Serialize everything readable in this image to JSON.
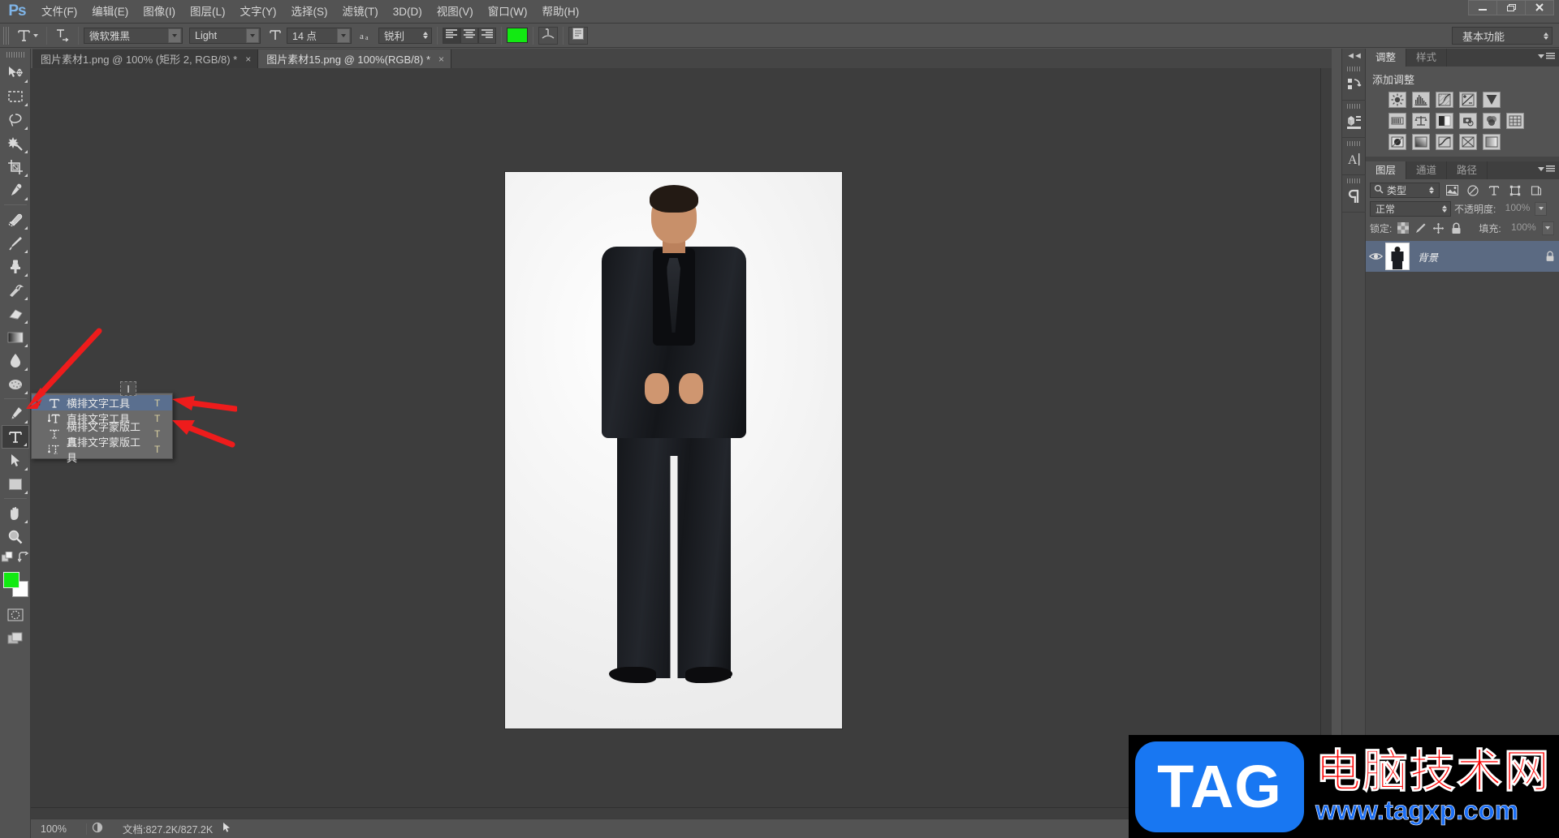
{
  "app": {
    "logo": "Ps",
    "workspace": "基本功能"
  },
  "menubar": {
    "items": [
      {
        "label": "文件(F)"
      },
      {
        "label": "编辑(E)"
      },
      {
        "label": "图像(I)"
      },
      {
        "label": "图层(L)"
      },
      {
        "label": "文字(Y)"
      },
      {
        "label": "选择(S)"
      },
      {
        "label": "滤镜(T)"
      },
      {
        "label": "3D(D)"
      },
      {
        "label": "视图(V)"
      },
      {
        "label": "窗口(W)"
      },
      {
        "label": "帮助(H)"
      }
    ],
    "window_controls": {
      "minimize": "minimize-icon",
      "restore": "restore-icon",
      "close": "close-icon"
    }
  },
  "options_bar": {
    "tool_icon": "horizontal-type-tool-icon",
    "orientation_icon": "toggle-text-orientation-icon",
    "font_family": "微软雅黑",
    "font_style": "Light",
    "size_icon": "font-size-icon",
    "font_size": "14 点",
    "aa_icon": "anti-alias-icon",
    "anti_alias": "锐利",
    "align": {
      "left": "align-left-icon",
      "center": "align-center-icon",
      "right": "align-right-icon",
      "selected": "left"
    },
    "text_color": "#12ea12",
    "warp_icon": "create-warped-text-icon",
    "panels_icon": "toggle-character-paragraph-panels-icon"
  },
  "tabs": [
    {
      "label": "图片素材1.png @ 100% (矩形 2, RGB/8) *",
      "close": "×",
      "active": false
    },
    {
      "label": "图片素材15.png @ 100%(RGB/8) *",
      "close": "×",
      "active": true
    }
  ],
  "toolbar": {
    "tools": [
      {
        "name": "move-tool",
        "icon": "move-tool-icon",
        "has_flyout": true
      },
      {
        "name": "rectangular-marquee-tool",
        "icon": "marquee-tool-icon",
        "has_flyout": true
      },
      {
        "name": "lasso-tool",
        "icon": "lasso-tool-icon",
        "has_flyout": true
      },
      {
        "name": "magic-wand-tool",
        "icon": "magic-wand-tool-icon",
        "has_flyout": true
      },
      {
        "name": "crop-tool",
        "icon": "crop-tool-icon",
        "has_flyout": true
      },
      {
        "name": "eyedropper-tool",
        "icon": "eyedropper-tool-icon",
        "has_flyout": true
      },
      {
        "name": "spot-healing-brush-tool",
        "icon": "healing-brush-tool-icon",
        "has_flyout": true
      },
      {
        "name": "brush-tool",
        "icon": "brush-tool-icon",
        "has_flyout": true
      },
      {
        "name": "clone-stamp-tool",
        "icon": "clone-stamp-tool-icon",
        "has_flyout": true
      },
      {
        "name": "history-brush-tool",
        "icon": "history-brush-tool-icon",
        "has_flyout": true
      },
      {
        "name": "eraser-tool",
        "icon": "eraser-tool-icon",
        "has_flyout": true
      },
      {
        "name": "gradient-tool",
        "icon": "gradient-tool-icon",
        "has_flyout": true
      },
      {
        "name": "blur-tool",
        "icon": "blur-tool-icon",
        "has_flyout": true
      },
      {
        "name": "dodge-tool",
        "icon": "dodge-tool-icon",
        "has_flyout": true
      },
      {
        "name": "pen-tool",
        "icon": "pen-tool-icon",
        "has_flyout": true
      },
      {
        "name": "type-tool",
        "icon": "type-tool-icon",
        "has_flyout": true,
        "selected": true
      },
      {
        "name": "path-selection-tool",
        "icon": "path-selection-tool-icon",
        "has_flyout": true
      },
      {
        "name": "rectangle-tool",
        "icon": "rectangle-shape-tool-icon",
        "has_flyout": true
      },
      {
        "name": "hand-tool",
        "icon": "hand-tool-icon",
        "has_flyout": true
      },
      {
        "name": "zoom-tool",
        "icon": "zoom-tool-icon",
        "has_flyout": false
      }
    ],
    "foreground_color": "#12ea12",
    "background_color": "#ffffff",
    "quick_mask_icon": "quick-mask-icon",
    "screen_mode_icon": "screen-mode-icon",
    "default_colors_icon": "default-colors-icon",
    "swap_colors_icon": "swap-colors-icon"
  },
  "flyout_menu": {
    "preview_icon": "type-tool-preview-icon",
    "items": [
      {
        "label": "横排文字工具",
        "shortcut": "T",
        "icon": "horizontal-type-tool-icon",
        "selected": true
      },
      {
        "label": "直排文字工具",
        "shortcut": "T",
        "icon": "vertical-type-tool-icon",
        "selected": false
      },
      {
        "label": "横排文字蒙版工具",
        "shortcut": "T",
        "icon": "horizontal-type-mask-tool-icon",
        "selected": false
      },
      {
        "label": "直排文字蒙版工具",
        "shortcut": "T",
        "icon": "vertical-type-mask-tool-icon",
        "selected": false
      }
    ]
  },
  "statusbar": {
    "zoom": "100%",
    "preview_icon": "preview-icon",
    "doc_info": "文档:827.2K/827.2K",
    "arrow_icon": "status-arrow-icon"
  },
  "dock_strip": {
    "collapse_icon": "collapse-to-icons-icon",
    "icons": [
      {
        "name": "history-panel-icon"
      },
      {
        "name": "mini-bridge-panel-icon"
      },
      {
        "name": "character-panel-icon"
      },
      {
        "name": "paragraph-panel-icon"
      }
    ]
  },
  "adjustments_panel": {
    "tabs": [
      {
        "label": "调整",
        "active": true
      },
      {
        "label": "样式",
        "active": false
      }
    ],
    "title": "添加调整",
    "buttons": [
      [
        "brightness-contrast-icon",
        "levels-icon",
        "curves-icon",
        "exposure-icon",
        "vibrance-icon"
      ],
      [
        "hue-saturation-icon",
        "color-balance-icon",
        "black-white-icon",
        "photo-filter-icon",
        "channel-mixer-icon",
        "color-lookup-icon"
      ],
      [
        "invert-icon",
        "posterize-icon",
        "threshold-icon",
        "gradient-map-icon",
        "selective-color-icon"
      ]
    ]
  },
  "layers_panel": {
    "tabs": [
      {
        "label": "图层",
        "active": true
      },
      {
        "label": "通道",
        "active": false
      },
      {
        "label": "路径",
        "active": false
      }
    ],
    "filter": {
      "search_icon": "search-icon",
      "label": "类型",
      "type_icons": [
        "filter-pixel-icon",
        "filter-adjustment-icon",
        "filter-type-icon",
        "filter-shape-icon",
        "filter-smart-object-icon"
      ]
    },
    "blend_mode": "正常",
    "opacity_label": "不透明度:",
    "opacity_value": "100%",
    "lock_label": "锁定:",
    "lock_icons": [
      "lock-transparent-pixels-icon",
      "lock-image-pixels-icon",
      "lock-position-icon",
      "lock-all-icon"
    ],
    "fill_label": "填充:",
    "fill_value": "100%",
    "layers": [
      {
        "name": "背景",
        "visible": true,
        "locked": true,
        "thumbnail": "background-layer-thumbnail",
        "selected": true
      }
    ]
  },
  "annotations": {
    "arrow_color": "#ee1c1c",
    "arrows": [
      {
        "name": "arrow-to-type-tool"
      },
      {
        "name": "arrow-to-horizontal-type-tool"
      },
      {
        "name": "arrow-to-vertical-type-tool"
      }
    ]
  },
  "watermark": {
    "logo_text": "TAG",
    "logo_color": "#1877f2",
    "site_name": "电脑技术网",
    "site_name_color": "#ff0000",
    "url": "www.tagxp.com",
    "url_color": "#1a6ef5"
  }
}
